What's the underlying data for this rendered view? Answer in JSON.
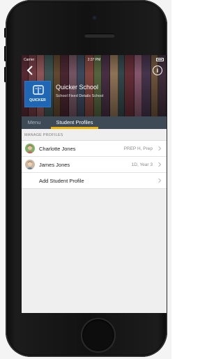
{
  "status_bar": {
    "carrier": "Carrier",
    "time": "2:37 PM"
  },
  "header": {
    "logo_text": "QUICKER",
    "school_name": "Quicker School",
    "school_subtitle": "School Fixed Details School"
  },
  "tabs": [
    {
      "label": "Menu",
      "active": false
    },
    {
      "label": "Student Profiles",
      "active": true
    }
  ],
  "section_heading": "MANAGE PROFILES",
  "profiles": [
    {
      "name": "Charlotte  Jones",
      "detail": "PREP H, Prep"
    },
    {
      "name": "James Jones",
      "detail": "1D, Year 3"
    }
  ],
  "add_profile_label": "Add Student Profile",
  "colors": {
    "tab_bar": "#3f4a57",
    "tab_active_underline": "#f0b400",
    "logo_background": "#1f66b5"
  },
  "icons": {
    "back": "chevron-left-icon",
    "info": "info-icon",
    "row_disclosure": "chevron-right-icon"
  }
}
